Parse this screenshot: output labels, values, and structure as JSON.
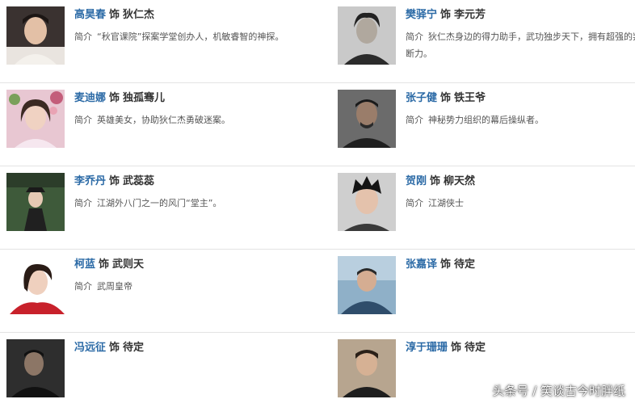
{
  "cast": [
    {
      "actor": "高昊春",
      "sep": "饰",
      "role": "狄仁杰",
      "desc_label": "简介",
      "desc": "“秋官课院”探案学堂创办人，机敏睿智的神探。"
    },
    {
      "actor": "樊驿宁",
      "sep": "饰",
      "role": "李元芳",
      "desc_label": "简介",
      "desc": "狄仁杰身边的得力助手，武功独步天下，拥有超强的判断力。"
    },
    {
      "actor": "麦迪娜",
      "sep": "饰",
      "role": "独孤骞儿",
      "desc_label": "简介",
      "desc": "英雄美女，协助狄仁杰勇破迷案。"
    },
    {
      "actor": "张子健",
      "sep": "饰",
      "role": "铁王爷",
      "desc_label": "简介",
      "desc": "神秘势力组织的幕后操纵者。"
    },
    {
      "actor": "李乔丹",
      "sep": "饰",
      "role": "武蕊蕊",
      "desc_label": "简介",
      "desc": "江湖外八门之一的风门“堂主”。"
    },
    {
      "actor": "贺刚",
      "sep": "饰",
      "role": "柳天然",
      "desc_label": "简介",
      "desc": "江湖侠士"
    },
    {
      "actor": "柯蓝",
      "sep": "饰",
      "role": "武则天",
      "desc_label": "简介",
      "desc": "武周皇帝"
    },
    {
      "actor": "张嘉译",
      "sep": "饰",
      "role": "待定",
      "desc_label": "",
      "desc": ""
    },
    {
      "actor": "冯远征",
      "sep": "饰",
      "role": "待定",
      "desc_label": "",
      "desc": ""
    },
    {
      "actor": "淳于珊珊",
      "sep": "饰",
      "role": "待定",
      "desc_label": "",
      "desc": ""
    }
  ],
  "watermark": "头条号 / 笑谈古今时胖纸",
  "colors": {
    "actor_link": "#2b6aa6",
    "divider": "#e3e3e3"
  }
}
